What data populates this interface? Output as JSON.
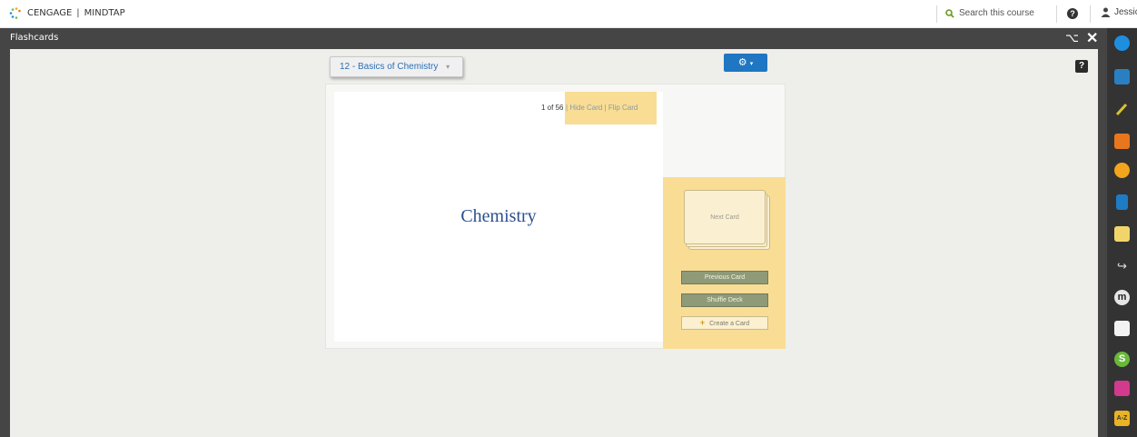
{
  "header": {
    "brand": "CENGAGE",
    "brand_sub": "MINDTAP",
    "search_text": "Search this course",
    "user_name": "Jessica"
  },
  "window": {
    "title": "Flashcards"
  },
  "toolbar": {
    "deck_select": "12 - Basics of Chemistry"
  },
  "card": {
    "counter": "1 of 56",
    "hide_label": "Hide Card",
    "flip_label": "Flip Card",
    "separator": "|",
    "term": "Chemistry"
  },
  "side": {
    "next_card": "Next Card",
    "previous_card": "Previous Card",
    "shuffle_deck": "Shuffle Deck",
    "create_card": "Create a Card"
  },
  "rail_icons": [
    {
      "name": "cengage-icon",
      "color": "#1e8fe0"
    },
    {
      "name": "briefcase-icon",
      "color": "#2a7fc0"
    },
    {
      "name": "pencil-icon",
      "color": "#c9b41e"
    },
    {
      "name": "rss-icon",
      "color": "#e8761f"
    },
    {
      "name": "circle-b-icon",
      "color": "#f2a51d"
    },
    {
      "name": "book-icon",
      "color": "#1e7cc5"
    },
    {
      "name": "notepad-icon",
      "color": "#e9c837"
    },
    {
      "name": "chemistry-link-icon",
      "color": "#cccccc"
    },
    {
      "name": "m-icon",
      "color": "#dddddd"
    },
    {
      "name": "comment-icon",
      "color": "#f5f5f5"
    },
    {
      "name": "s-icon",
      "color": "#69b83a"
    },
    {
      "name": "chat-icon",
      "color": "#d23a8d"
    },
    {
      "name": "az-icon",
      "color": "#e8b324"
    }
  ],
  "colors": {
    "frame": "#454545",
    "accent_blue": "#1f76c2",
    "highlight_yellow": "#f9dd94",
    "button_green": "#8f9a78"
  }
}
